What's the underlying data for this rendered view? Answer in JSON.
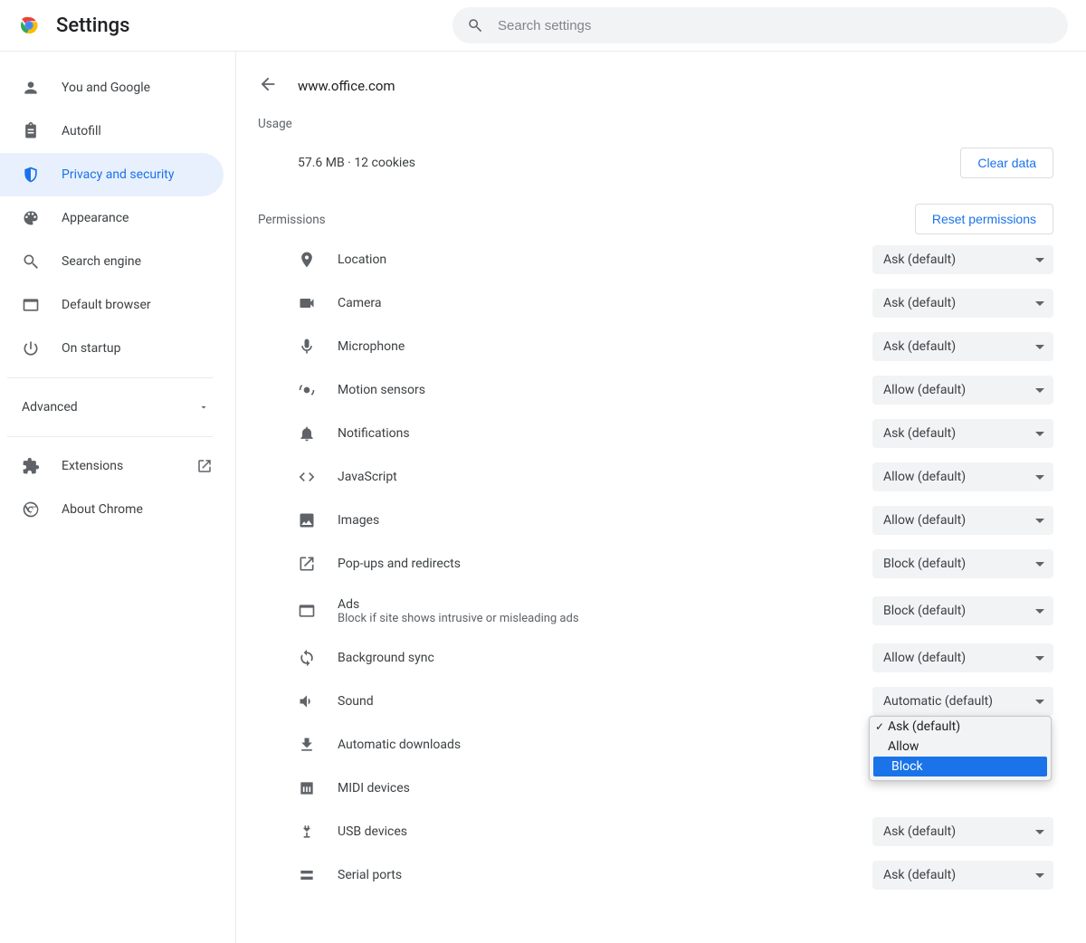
{
  "header": {
    "title": "Settings",
    "search_placeholder": "Search settings"
  },
  "sidebar": {
    "items": [
      {
        "label": "You and Google"
      },
      {
        "label": "Autofill"
      },
      {
        "label": "Privacy and security"
      },
      {
        "label": "Appearance"
      },
      {
        "label": "Search engine"
      },
      {
        "label": "Default browser"
      },
      {
        "label": "On startup"
      }
    ],
    "advanced_label": "Advanced",
    "extensions_label": "Extensions",
    "about_label": "About Chrome"
  },
  "main": {
    "site_title": "www.office.com",
    "usage_heading": "Usage",
    "usage_value": "57.6 MB · 12 cookies",
    "clear_data_label": "Clear data",
    "permissions_heading": "Permissions",
    "reset_permissions_label": "Reset permissions",
    "permissions": [
      {
        "label": "Location",
        "value": "Ask (default)"
      },
      {
        "label": "Camera",
        "value": "Ask (default)"
      },
      {
        "label": "Microphone",
        "value": "Ask (default)"
      },
      {
        "label": "Motion sensors",
        "value": "Allow (default)"
      },
      {
        "label": "Notifications",
        "value": "Ask (default)"
      },
      {
        "label": "JavaScript",
        "value": "Allow (default)"
      },
      {
        "label": "Images",
        "value": "Allow (default)"
      },
      {
        "label": "Pop-ups and redirects",
        "value": "Block (default)"
      },
      {
        "label": "Ads",
        "sub": "Block if site shows intrusive or misleading ads",
        "value": "Block (default)"
      },
      {
        "label": "Background sync",
        "value": "Allow (default)"
      },
      {
        "label": "Sound",
        "value": "Automatic (default)"
      },
      {
        "label": "Automatic downloads",
        "value": "Ask (default)",
        "open": true
      },
      {
        "label": "MIDI devices"
      },
      {
        "label": "USB devices",
        "value": "Ask (default)"
      },
      {
        "label": "Serial ports",
        "value": "Ask (default)"
      }
    ],
    "dropdown": {
      "options": [
        {
          "label": "Ask (default)",
          "checked": true
        },
        {
          "label": "Allow"
        },
        {
          "label": "Block",
          "highlight": true
        }
      ]
    }
  }
}
